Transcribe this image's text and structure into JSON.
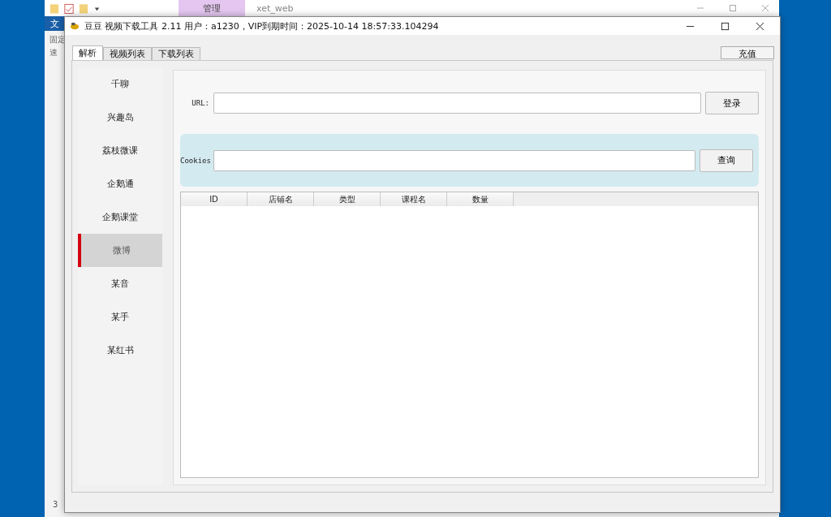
{
  "background_window": {
    "ribbon_tab": "管理",
    "folder": "xet_web",
    "file_tab": "文",
    "side_texts": [
      "固定",
      "速"
    ],
    "status": "3"
  },
  "window": {
    "title": "豆豆 视频下载工具 2.11 用户：a1230，VIP到期时间：2025-10-14 18:57:33.104294"
  },
  "tabs": [
    {
      "label": "解析",
      "selected": true
    },
    {
      "label": "视频列表",
      "selected": false
    },
    {
      "label": "下载列表",
      "selected": false
    }
  ],
  "recharge_button": "充值",
  "sidebar": {
    "items": [
      {
        "label": "千聊",
        "selected": false
      },
      {
        "label": "兴趣岛",
        "selected": false
      },
      {
        "label": "荔枝微课",
        "selected": false
      },
      {
        "label": "企鹅通",
        "selected": false
      },
      {
        "label": "企鹅课堂",
        "selected": false
      },
      {
        "label": "微博",
        "selected": true
      },
      {
        "label": "某音",
        "selected": false
      },
      {
        "label": "某手",
        "selected": false
      },
      {
        "label": "某红书",
        "selected": false
      }
    ]
  },
  "url_row": {
    "label": "URL:",
    "button": "登录"
  },
  "cookies_row": {
    "label": "Cookies",
    "button": "查询"
  },
  "table": {
    "columns": [
      "ID",
      "店铺名",
      "类型",
      "课程名",
      "数量"
    ]
  }
}
